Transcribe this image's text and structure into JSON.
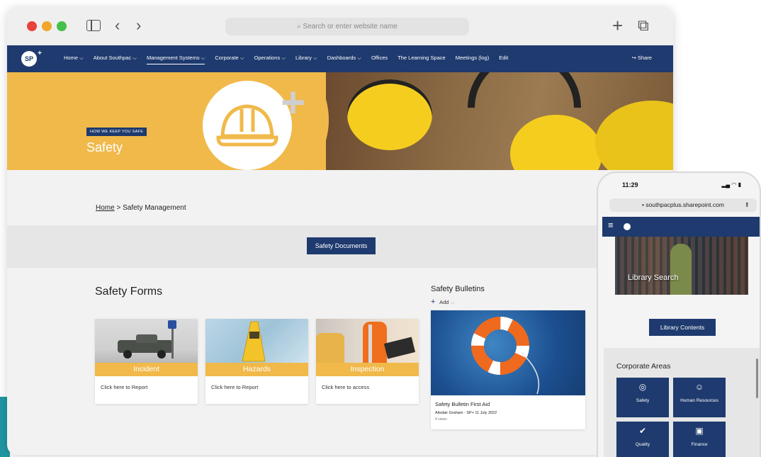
{
  "browser": {
    "address_placeholder": "Search or enter website name",
    "back_icon": "chevron-left-icon",
    "forward_icon": "chevron-right-icon",
    "new_tab_icon": "plus-icon",
    "tabs_icon": "tabs-icon"
  },
  "site": {
    "logo_text": "SP",
    "nav": [
      {
        "label": "Home",
        "has_dropdown": true
      },
      {
        "label": "About Southpac",
        "has_dropdown": true
      },
      {
        "label": "Management Systems",
        "has_dropdown": true,
        "active": true
      },
      {
        "label": "Corporate",
        "has_dropdown": true
      },
      {
        "label": "Operations",
        "has_dropdown": true
      },
      {
        "label": "Library",
        "has_dropdown": true
      },
      {
        "label": "Dashboards",
        "has_dropdown": true
      },
      {
        "label": "Offices",
        "has_dropdown": false
      },
      {
        "label": "The Learning Space",
        "has_dropdown": false
      },
      {
        "label": "Meetings (log)",
        "has_dropdown": false
      },
      {
        "label": "Edit",
        "has_dropdown": false
      }
    ],
    "share_label": "Share"
  },
  "hero": {
    "kicker": "HOW WE KEEP YOU SAFE",
    "title": "Safety"
  },
  "breadcrumb": {
    "home": "Home",
    "separator": ">",
    "current": "Safety Management"
  },
  "documents_button": "Safety Documents",
  "forms": {
    "title": "Safety Forms",
    "cards": [
      {
        "label": "Incident",
        "link": "Click here to Report"
      },
      {
        "label": "Hazards",
        "link": "Click here to Report"
      },
      {
        "label": "Inspection",
        "link": "Click here to access"
      }
    ]
  },
  "bulletins": {
    "title": "Safety Bulletins",
    "add_label": "Add",
    "item": {
      "headline": "Safety Bulletin First Aid",
      "meta": "Alisdair Graham - SP+ 11 July 2022",
      "views": "4 views"
    }
  },
  "phone": {
    "time": "11:29",
    "url": "southpacplus.sharepoint.com",
    "image_label": "Library Search",
    "button": "Library Contents",
    "corporate_title": "Corporate Areas",
    "tiles": [
      {
        "label": "Safety",
        "icon": "lifebuoy-icon"
      },
      {
        "label": "Human Resources",
        "icon": "people-icon"
      },
      {
        "label": "Quality",
        "icon": "badge-icon"
      },
      {
        "label": "Finance",
        "icon": "money-icon"
      }
    ]
  },
  "colors": {
    "brand_navy": "#1e3a6e",
    "accent_gold": "#f0b94a",
    "teal": "#1f97a3"
  }
}
